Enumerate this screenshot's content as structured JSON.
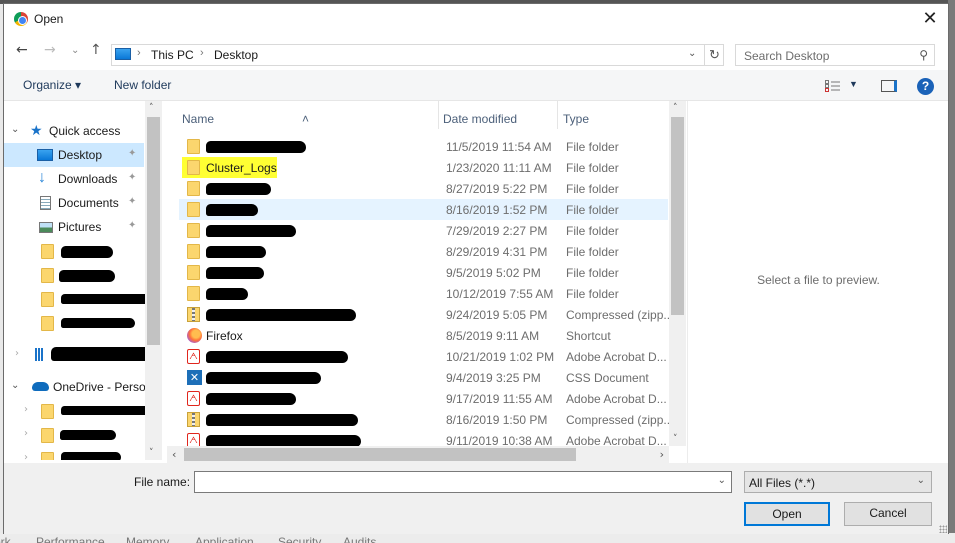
{
  "window": {
    "title": "Open",
    "close_label": "✕"
  },
  "navigation": {
    "back": "←",
    "forward": "→",
    "recent": "⌄",
    "up": "↑",
    "breadcrumb": [
      "This PC",
      "Desktop"
    ],
    "breadcrumb_separator": "›",
    "address_dropdown": "⌄",
    "refresh": "↻"
  },
  "search": {
    "placeholder": "Search Desktop",
    "icon": "⚲"
  },
  "toolbar": {
    "organize_label": "Organize ▾",
    "new_folder_label": "New folder",
    "view_dropdown": "▼",
    "help_label": "?"
  },
  "sidebar": {
    "items": [
      {
        "label": "Quick access",
        "icon": "star-icon",
        "expanded": true
      },
      {
        "label": "Desktop",
        "icon": "desktop-icon",
        "pinned": true,
        "selected": true
      },
      {
        "label": "Downloads",
        "icon": "download-icon",
        "pinned": true
      },
      {
        "label": "Documents",
        "icon": "documents-icon",
        "pinned": true
      },
      {
        "label": "Pictures",
        "icon": "pictures-icon",
        "pinned": true
      },
      {
        "label": "",
        "icon": "folder-icon",
        "redacted": true
      },
      {
        "label": "",
        "icon": "folder-icon",
        "redacted": true
      },
      {
        "label": "",
        "icon": "folder-icon",
        "redacted": true
      },
      {
        "label": "",
        "icon": "folder-icon",
        "redacted": true
      },
      {
        "label": "",
        "icon": "building-icon",
        "redacted": true
      },
      {
        "label": "OneDrive - Persor",
        "icon": "cloud-icon",
        "expanded": true
      },
      {
        "label": "",
        "icon": "folder-icon",
        "redacted": true
      },
      {
        "label": "",
        "icon": "folder-icon",
        "redacted": true
      },
      {
        "label": "",
        "icon": "folder-icon",
        "redacted": true
      }
    ],
    "pin_glyph": "📌"
  },
  "file_list": {
    "columns": [
      "Name",
      "Date modified",
      "Type"
    ],
    "rows": [
      {
        "name": "",
        "redacted": true,
        "date": "11/5/2019 11:54 AM",
        "type": "File folder",
        "icon": "folder"
      },
      {
        "name": "Cluster_Logs",
        "highlighted": true,
        "date": "1/23/2020 11:11 AM",
        "type": "File folder",
        "icon": "folder"
      },
      {
        "name": "",
        "redacted": true,
        "date": "8/27/2019 5:22 PM",
        "type": "File folder",
        "icon": "folder"
      },
      {
        "name": "",
        "redacted": true,
        "hover": true,
        "date": "8/16/2019 1:52 PM",
        "type": "File folder",
        "icon": "folder"
      },
      {
        "name": "",
        "redacted": true,
        "date": "7/29/2019 2:27 PM",
        "type": "File folder",
        "icon": "folder"
      },
      {
        "name": "",
        "redacted": true,
        "date": "8/29/2019 4:31 PM",
        "type": "File folder",
        "icon": "folder"
      },
      {
        "name": "",
        "redacted": true,
        "date": "9/5/2019 5:02 PM",
        "type": "File folder",
        "icon": "folder"
      },
      {
        "name": "",
        "redacted": true,
        "date": "10/12/2019 7:55 AM",
        "type": "File folder",
        "icon": "folder"
      },
      {
        "name": "",
        "redacted": true,
        "date": "9/24/2019 5:05 PM",
        "type": "Compressed (zipp...",
        "icon": "zip"
      },
      {
        "name": "Firefox",
        "date": "8/5/2019 9:11 AM",
        "type": "Shortcut",
        "icon": "firefox"
      },
      {
        "name": "",
        "redacted": true,
        "date": "10/21/2019 1:02 PM",
        "type": "Adobe Acrobat D...",
        "icon": "pdf"
      },
      {
        "name": "",
        "redacted": true,
        "date": "9/4/2019 3:25 PM",
        "type": "CSS Document",
        "icon": "css"
      },
      {
        "name": "",
        "redacted": true,
        "date": "9/17/2019 11:55 AM",
        "type": "Adobe Acrobat D...",
        "icon": "pdf"
      },
      {
        "name": "",
        "redacted": true,
        "date": "8/16/2019 1:50 PM",
        "type": "Compressed (zipp...",
        "icon": "zip"
      },
      {
        "name": "",
        "redacted": true,
        "date": "9/11/2019 10:38 AM",
        "type": "Adobe Acrobat D...",
        "icon": "pdf"
      }
    ]
  },
  "preview": {
    "message": "Select a file to preview."
  },
  "footer": {
    "file_name_label": "File name:",
    "file_name_value": "",
    "file_type_selected": "All Files (*.*)",
    "open_label": "Open",
    "cancel_label": "Cancel"
  },
  "background_tabs": [
    "ork",
    "Performance",
    "Memory",
    "Application",
    "Security",
    "Audits"
  ],
  "colors": {
    "accent": "#0078d7",
    "selection": "#cce8ff",
    "hover": "#e5f3ff",
    "highlight": "#ffff33",
    "folder": "#fbd66e"
  }
}
